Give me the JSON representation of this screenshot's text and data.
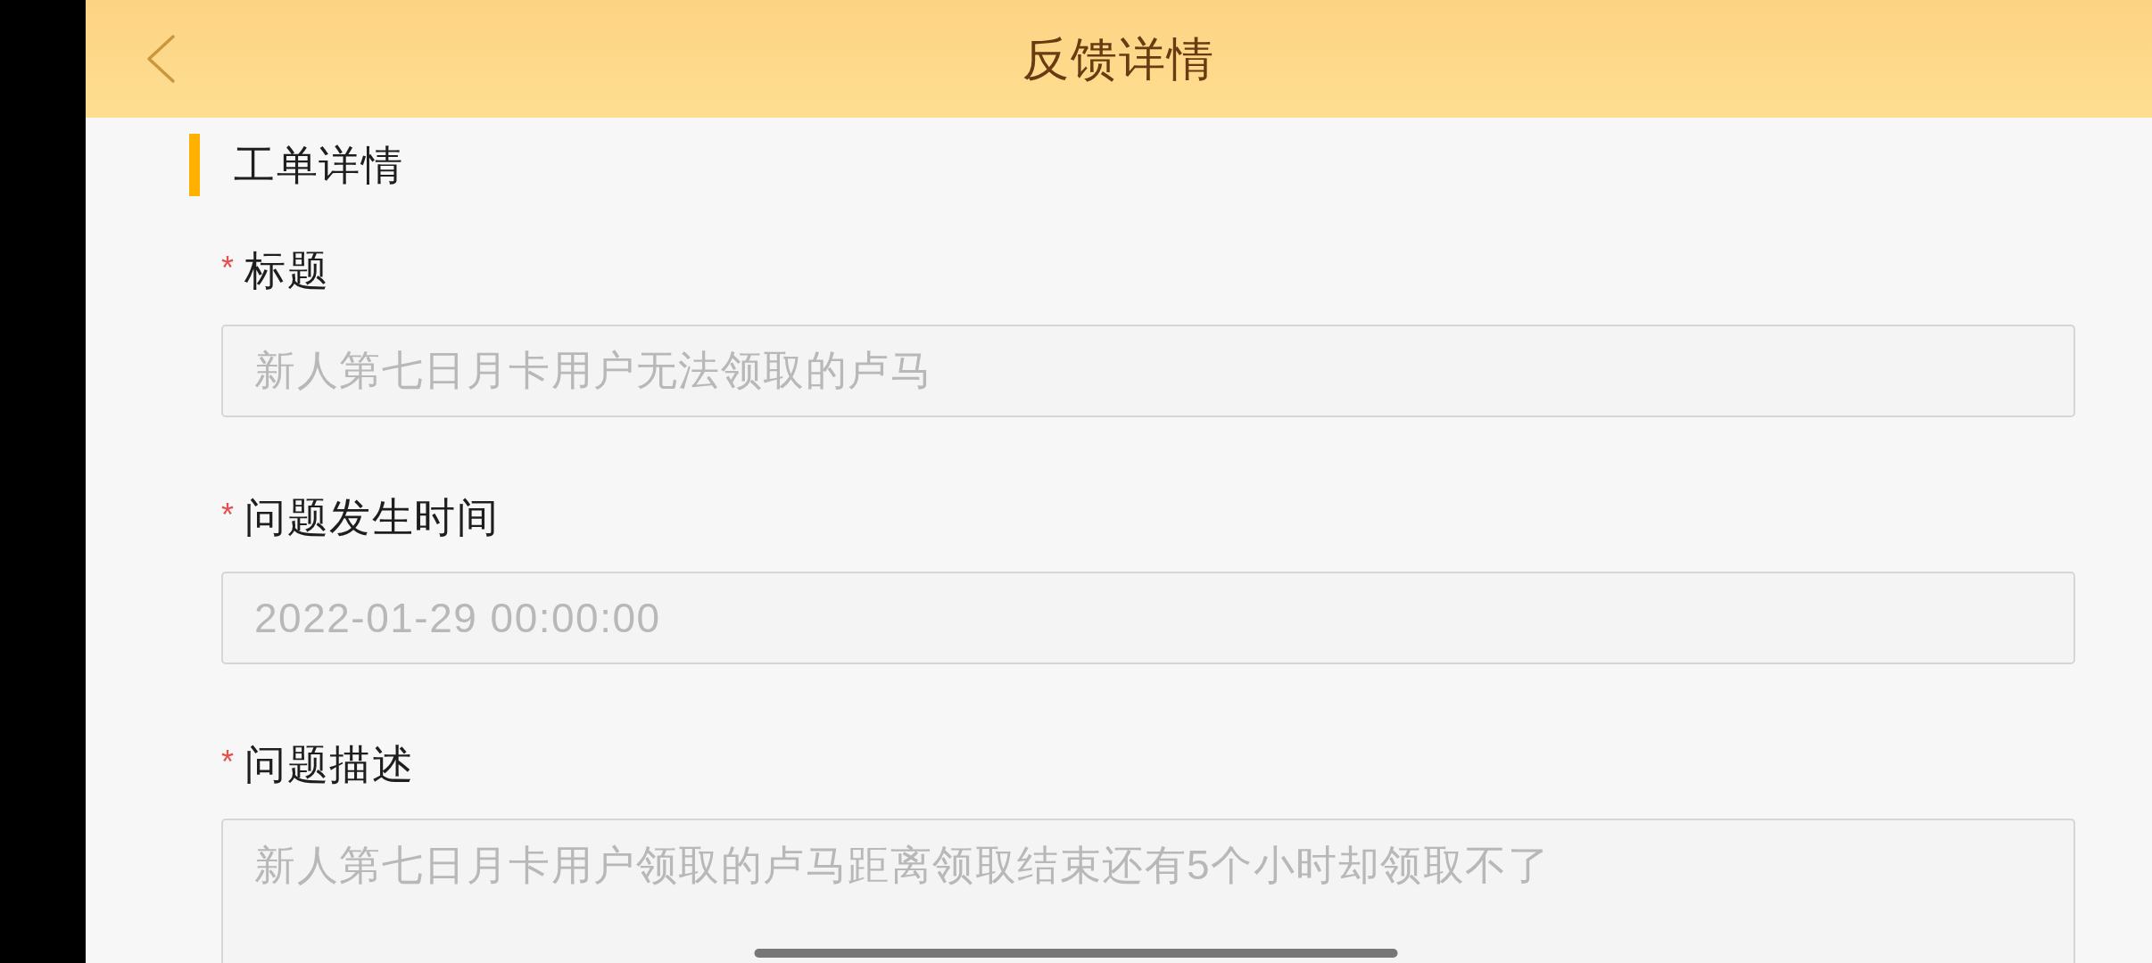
{
  "header": {
    "title": "反馈详情"
  },
  "section": {
    "title": "工单详情"
  },
  "fields": [
    {
      "kind": "input",
      "required_mark": "*",
      "label": "标题",
      "value": "新人第七日月卡用户无法领取的卢马",
      "disabled": true
    },
    {
      "kind": "input",
      "required_mark": "*",
      "label": "问题发生时间",
      "value": "2022-01-29 00:00:00",
      "disabled": true
    },
    {
      "kind": "textarea",
      "required_mark": "*",
      "label": "问题描述",
      "value": "新人第七日月卡用户领取的卢马距离领取结束还有5个小时却领取不了",
      "disabled": true
    }
  ]
}
